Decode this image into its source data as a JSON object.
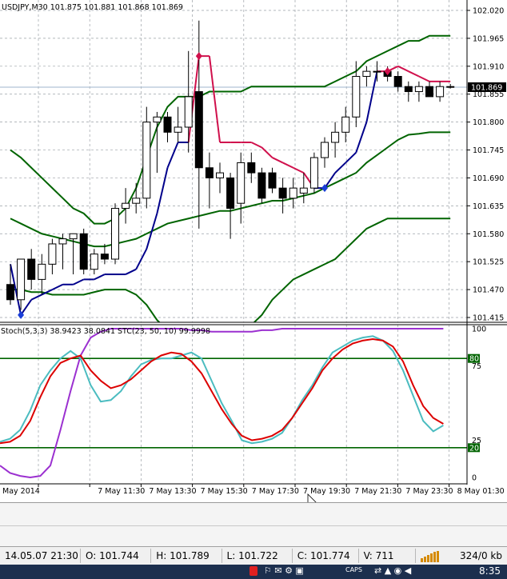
{
  "header": {
    "symbol_line": "USDJPY,M30  101.875 101.881 101.868 101.869",
    "stoch_line": "Stoch(5,3,3) 38.9423 38.0841  STC(23, 50, 10) 99.9998"
  },
  "colors": {
    "bull_fill": "#ffffff",
    "bear_fill": "#000000",
    "band": "#006400",
    "stoch_main": "#4bbcc0",
    "stoch_signal": "#dc0000",
    "stc": "#9b30d0",
    "trail_up": "#00008b",
    "trail_down": "#d0104c",
    "grid": "#9aa0a6",
    "level": "#006400"
  },
  "price_axis": [
    "102.020",
    "101.965",
    "101.910",
    "101.855",
    "101.800",
    "101.745",
    "101.690",
    "101.635",
    "101.580",
    "101.525",
    "101.470",
    "101.415"
  ],
  "current_price_tag": "101.869",
  "osc_axis": [
    "100",
    "75",
    "25",
    "0"
  ],
  "osc_level_tags": [
    "80",
    "20"
  ],
  "time_axis": [
    "May 2014",
    "7 May 11:30",
    "7 May 13:30",
    "7 May 15:30",
    "7 May 17:30",
    "7 May 19:30",
    "7 May 21:30",
    "7 May 23:30",
    "8 May 01:30"
  ],
  "chart_data": {
    "type": "candlestick",
    "symbol": "USDJPY",
    "timeframe": "M30",
    "ylim": [
      101.4,
      102.03
    ],
    "series": [
      {
        "o": 101.48,
        "h": 101.52,
        "l": 101.44,
        "c": 101.45
      },
      {
        "o": 101.45,
        "h": 101.52,
        "l": 101.43,
        "c": 101.53
      },
      {
        "o": 101.53,
        "h": 101.55,
        "l": 101.47,
        "c": 101.49
      },
      {
        "o": 101.49,
        "h": 101.54,
        "l": 101.46,
        "c": 101.52
      },
      {
        "o": 101.52,
        "h": 101.57,
        "l": 101.5,
        "c": 101.56
      },
      {
        "o": 101.56,
        "h": 101.58,
        "l": 101.51,
        "c": 101.57
      },
      {
        "o": 101.57,
        "h": 101.58,
        "l": 101.5,
        "c": 101.58
      },
      {
        "o": 101.58,
        "h": 101.59,
        "l": 101.5,
        "c": 101.51
      },
      {
        "o": 101.51,
        "h": 101.55,
        "l": 101.5,
        "c": 101.54
      },
      {
        "o": 101.54,
        "h": 101.56,
        "l": 101.52,
        "c": 101.53
      },
      {
        "o": 101.53,
        "h": 101.64,
        "l": 101.52,
        "c": 101.63
      },
      {
        "o": 101.63,
        "h": 101.67,
        "l": 101.6,
        "c": 101.64
      },
      {
        "o": 101.64,
        "h": 101.68,
        "l": 101.62,
        "c": 101.65
      },
      {
        "o": 101.65,
        "h": 101.83,
        "l": 101.63,
        "c": 101.8
      },
      {
        "o": 101.8,
        "h": 101.82,
        "l": 101.7,
        "c": 101.81
      },
      {
        "o": 101.81,
        "h": 101.82,
        "l": 101.76,
        "c": 101.78
      },
      {
        "o": 101.78,
        "h": 101.83,
        "l": 101.76,
        "c": 101.79
      },
      {
        "o": 101.79,
        "h": 101.94,
        "l": 101.74,
        "c": 101.85
      },
      {
        "o": 101.86,
        "h": 102.0,
        "l": 101.59,
        "c": 101.71
      },
      {
        "o": 101.71,
        "h": 101.74,
        "l": 101.63,
        "c": 101.69
      },
      {
        "o": 101.69,
        "h": 101.72,
        "l": 101.66,
        "c": 101.7
      },
      {
        "o": 101.69,
        "h": 101.7,
        "l": 101.57,
        "c": 101.63
      },
      {
        "o": 101.64,
        "h": 101.74,
        "l": 101.6,
        "c": 101.72
      },
      {
        "o": 101.72,
        "h": 101.74,
        "l": 101.68,
        "c": 101.7
      },
      {
        "o": 101.7,
        "h": 101.71,
        "l": 101.64,
        "c": 101.65
      },
      {
        "o": 101.7,
        "h": 101.71,
        "l": 101.66,
        "c": 101.67
      },
      {
        "o": 101.67,
        "h": 101.69,
        "l": 101.62,
        "c": 101.65
      },
      {
        "o": 101.65,
        "h": 101.69,
        "l": 101.63,
        "c": 101.67
      },
      {
        "o": 101.66,
        "h": 101.7,
        "l": 101.64,
        "c": 101.67
      },
      {
        "o": 101.67,
        "h": 101.74,
        "l": 101.66,
        "c": 101.73
      },
      {
        "o": 101.73,
        "h": 101.77,
        "l": 101.71,
        "c": 101.76
      },
      {
        "o": 101.76,
        "h": 101.8,
        "l": 101.73,
        "c": 101.78
      },
      {
        "o": 101.78,
        "h": 101.83,
        "l": 101.76,
        "c": 101.81
      },
      {
        "o": 101.81,
        "h": 101.92,
        "l": 101.79,
        "c": 101.89
      },
      {
        "o": 101.89,
        "h": 101.91,
        "l": 101.87,
        "c": 101.9
      },
      {
        "o": 101.9,
        "h": 101.92,
        "l": 101.88,
        "c": 101.9
      },
      {
        "o": 101.9,
        "h": 101.91,
        "l": 101.88,
        "c": 101.89
      },
      {
        "o": 101.89,
        "h": 101.9,
        "l": 101.86,
        "c": 101.87
      },
      {
        "o": 101.87,
        "h": 101.88,
        "l": 101.84,
        "c": 101.86
      },
      {
        "o": 101.86,
        "h": 101.88,
        "l": 101.84,
        "c": 101.87
      },
      {
        "o": 101.87,
        "h": 101.88,
        "l": 101.85,
        "c": 101.85
      },
      {
        "o": 101.85,
        "h": 101.88,
        "l": 101.84,
        "c": 101.87
      },
      {
        "o": 101.87,
        "h": 101.875,
        "l": 101.866,
        "c": 101.869
      }
    ],
    "bands": {
      "upper": [
        101.745,
        101.73,
        101.71,
        101.69,
        101.67,
        101.65,
        101.63,
        101.62,
        101.6,
        101.6,
        101.61,
        101.63,
        101.67,
        101.73,
        101.79,
        101.83,
        101.85,
        101.85,
        101.85,
        101.86,
        101.86,
        101.86,
        101.86,
        101.87,
        101.87,
        101.87,
        101.87,
        101.87,
        101.87,
        101.87,
        101.87,
        101.88,
        101.89,
        101.9,
        101.92,
        101.93,
        101.94,
        101.95,
        101.96,
        101.96,
        101.97,
        101.97,
        101.97
      ],
      "middle": [
        101.61,
        101.6,
        101.59,
        101.58,
        101.575,
        101.57,
        101.565,
        101.56,
        101.555,
        101.555,
        101.56,
        101.565,
        101.57,
        101.58,
        101.59,
        101.6,
        101.605,
        101.61,
        101.615,
        101.62,
        101.625,
        101.625,
        101.63,
        101.635,
        101.64,
        101.645,
        101.645,
        101.65,
        101.655,
        101.66,
        101.67,
        101.68,
        101.69,
        101.7,
        101.72,
        101.735,
        101.75,
        101.765,
        101.775,
        101.777,
        101.78,
        101.78,
        101.78
      ],
      "lower": [
        101.47,
        101.47,
        101.465,
        101.465,
        101.46,
        101.46,
        101.46,
        101.46,
        101.465,
        101.47,
        101.47,
        101.47,
        101.46,
        101.44,
        101.41,
        101.39,
        101.38,
        101.37,
        101.37,
        101.37,
        101.37,
        101.37,
        101.38,
        101.4,
        101.42,
        101.45,
        101.47,
        101.49,
        101.5,
        101.51,
        101.52,
        101.53,
        101.55,
        101.57,
        101.59,
        101.6,
        101.61,
        101.61,
        101.61,
        101.61,
        101.61,
        101.61,
        101.61
      ]
    },
    "trail": {
      "values": [
        101.52,
        101.42,
        101.45,
        101.46,
        101.47,
        101.48,
        101.48,
        101.49,
        101.49,
        101.5,
        101.5,
        101.5,
        101.51,
        101.55,
        101.62,
        101.71,
        101.76,
        101.76,
        101.93,
        101.93,
        101.76,
        101.76,
        101.76,
        101.76,
        101.75,
        101.73,
        101.72,
        101.71,
        101.7,
        101.67,
        101.67,
        101.7,
        101.72,
        101.74,
        101.8,
        101.9,
        101.9,
        101.91,
        101.9,
        101.89,
        101.88,
        101.88,
        101.88
      ],
      "dir": [
        1,
        1,
        1,
        1,
        1,
        1,
        1,
        1,
        1,
        1,
        1,
        1,
        1,
        1,
        1,
        1,
        1,
        1,
        -1,
        -1,
        -1,
        -1,
        -1,
        -1,
        -1,
        -1,
        -1,
        -1,
        -1,
        -1,
        1,
        1,
        1,
        1,
        1,
        1,
        -1,
        -1,
        -1,
        -1,
        -1,
        -1,
        -1
      ],
      "signals": [
        {
          "i": 1,
          "dir": 1
        },
        {
          "i": 18,
          "dir": -1
        },
        {
          "i": 30,
          "dir": 1
        },
        {
          "i": 36,
          "dir": -1
        }
      ]
    },
    "stoch_main": [
      24,
      26,
      32,
      45,
      62,
      72,
      80,
      85,
      80,
      62,
      51,
      52,
      58,
      68,
      76,
      79,
      80,
      80,
      82,
      84,
      80,
      65,
      50,
      38,
      25,
      23,
      24,
      26,
      30,
      40,
      52,
      62,
      74,
      84,
      88,
      92,
      94,
      95,
      92,
      85,
      72,
      55,
      38,
      31,
      35
    ],
    "stoch_signal": [
      23,
      24,
      28,
      38,
      54,
      68,
      77,
      80,
      82,
      72,
      65,
      60,
      62,
      66,
      72,
      78,
      82,
      84,
      83,
      78,
      70,
      58,
      46,
      36,
      28,
      25,
      26,
      28,
      32,
      40,
      50,
      60,
      72,
      80,
      86,
      90,
      92,
      93,
      92,
      88,
      78,
      62,
      48,
      40,
      36
    ],
    "stc": [
      8,
      3,
      1,
      0,
      1,
      8,
      32,
      58,
      82,
      94,
      98,
      100,
      100,
      100,
      100,
      100,
      100,
      100,
      100,
      99,
      99,
      98,
      98,
      98,
      98,
      98,
      99,
      99,
      100,
      100,
      100,
      100,
      100,
      100,
      100,
      100,
      100,
      100,
      100,
      100,
      100,
      100,
      100,
      100,
      100
    ],
    "osc_levels": [
      80,
      20
    ]
  },
  "status": {
    "time": "14.05.07 21:30",
    "open": "O: 101.744",
    "high": "H: 101.789",
    "low": "L: 101.722",
    "close": "C: 101.774",
    "volume": "V: 711",
    "traffic": "324/0 kb"
  },
  "taskbar": {
    "caps": "CAPS",
    "clock": "8:35"
  }
}
